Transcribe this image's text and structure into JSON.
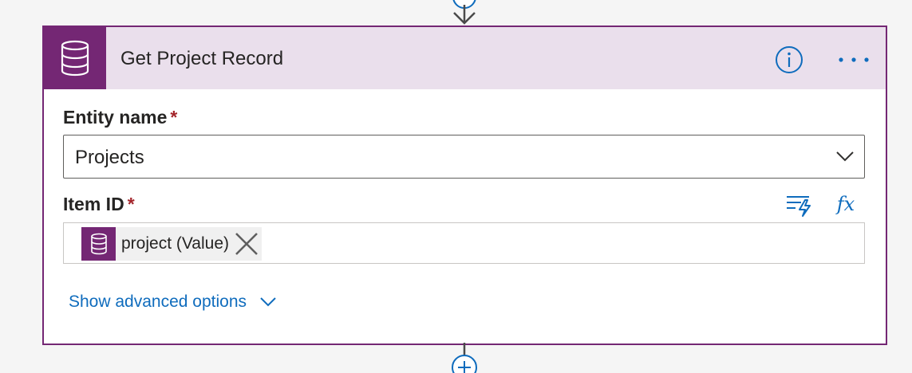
{
  "action": {
    "title": "Get Project Record",
    "icon": "database-icon",
    "info_icon": "info-icon",
    "menu_icon": "more-horizontal-icon"
  },
  "fields": {
    "entity": {
      "label": "Entity name",
      "required_marker": "*",
      "value": "Projects",
      "icon": "chevron-down-icon"
    },
    "item_id": {
      "label": "Item ID",
      "required_marker": "*",
      "token_label": "project (Value)",
      "token_icon": "database-icon",
      "remove_icon": "close-icon",
      "dynamic_content_icon": "dynamic-content-icon",
      "expression_icon": "fx-icon",
      "expression_label": "fx"
    }
  },
  "advanced": {
    "label": "Show advanced options",
    "icon": "chevron-down-icon"
  },
  "colors": {
    "accent": "#742774",
    "header_bg": "#eadfec",
    "link": "#0f6cbd",
    "required": "#a4262c"
  }
}
